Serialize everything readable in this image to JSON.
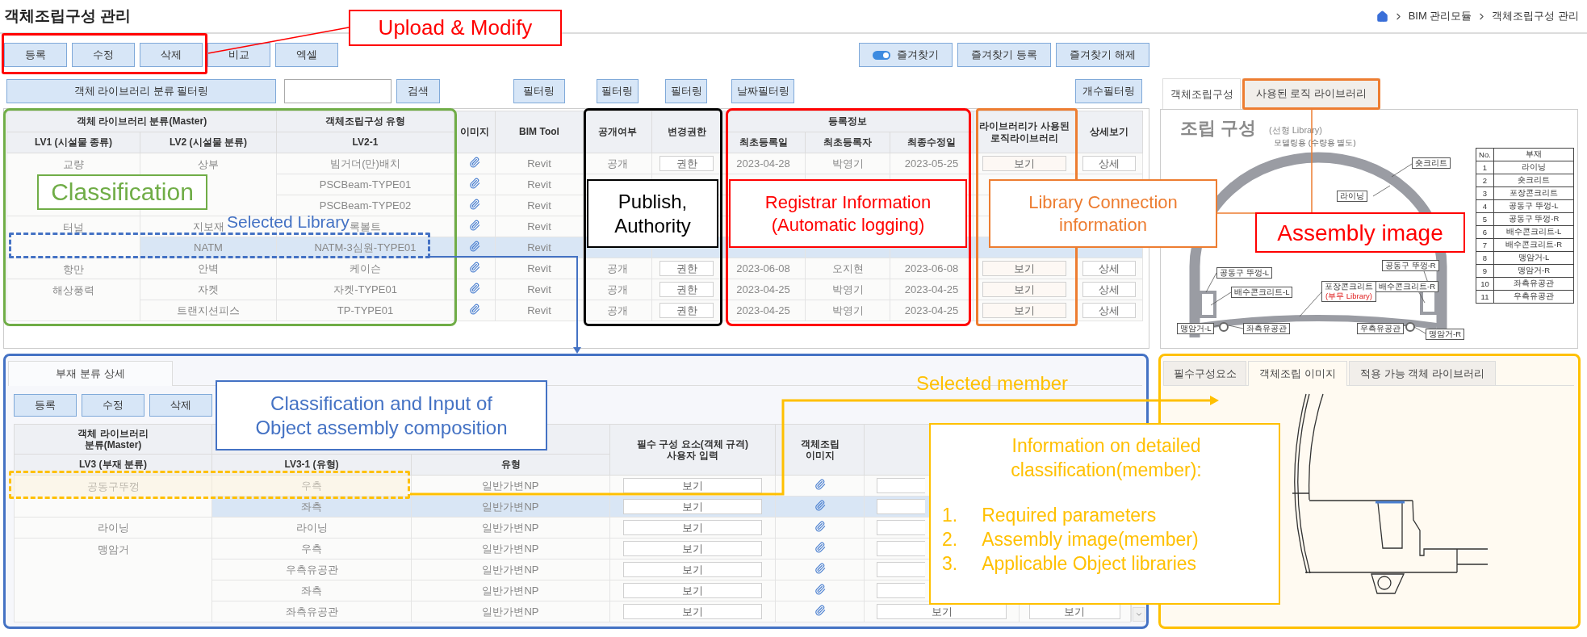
{
  "header": {
    "title": "객체조립구성 관리",
    "breadcrumb": [
      "BIM 관리모듈",
      "객체조립구성 관리"
    ]
  },
  "toolbar": {
    "actions": [
      "등록",
      "수정",
      "삭제",
      "비교",
      "엑셀"
    ],
    "favorites": {
      "label": "즐겨찾기",
      "on": true
    },
    "favorite_actions": [
      "즐겨찾기 등록",
      "즐겨찾기 해제"
    ]
  },
  "filters": {
    "category": "객체 라이브러리 분류 필터링",
    "search_button": "검색",
    "tool_filter": "필터링",
    "public_filter": "필터링",
    "authority_filter": "필터링",
    "date_filter": "날짜필터링",
    "count_filter": "개수필터링"
  },
  "library_table": {
    "header": {
      "master": "객체 라이브러리 분류(Master)",
      "assembly_type": "객체조립구성 유형",
      "lv1": "LV1 (시설물 종류)",
      "lv2": "LV2 (시설물 분류)",
      "lv2_1": "LV2-1",
      "image": "이미지",
      "tool": "BIM Tool",
      "public": "공개여부",
      "authority": "변경권한",
      "registration": "등록정보",
      "registered": "최초등록일",
      "registrar": "최초등록자",
      "modified": "최종수정일",
      "logic_library": "라이브러리가 사용된\n로직라이브러리",
      "detail": "상세보기"
    },
    "groups": [
      {
        "lv1": "교량",
        "subgroups": [
          {
            "lv2": "상부",
            "items": [
              {
                "type": "빔거더(만)배치",
                "tool": "Revit",
                "public": "공개",
                "authority": "권한",
                "registered": "2023-04-28",
                "registrar": "박영기",
                "modified": "2023-05-25",
                "logic": "보기",
                "detail": "상세",
                "selected": false
              },
              {
                "type": "PSCBeam-TYPE01",
                "tool": "Revit",
                "selected": false
              },
              {
                "type": "PSCBeam-TYPE02",
                "tool": "Revit",
                "selected": false
              }
            ]
          }
        ]
      },
      {
        "lv1": "터널",
        "subgroups": [
          {
            "lv2": "지보재",
            "items": [
              {
                "type": "록볼트",
                "tool": "Revit",
                "selected": false
              }
            ]
          },
          {
            "lv2": "NATM",
            "items": [
              {
                "type": "NATM-3심원-TYPE01",
                "tool": "Revit",
                "selected": true
              }
            ]
          }
        ]
      },
      {
        "lv1": "항만",
        "subgroups": [
          {
            "lv2": "안벽",
            "items": [
              {
                "type": "케이슨",
                "tool": "Revit",
                "public": "공개",
                "authority": "권한",
                "registered": "2023-06-08",
                "registrar": "오지현",
                "modified": "2023-06-08",
                "logic": "보기",
                "detail": "상세",
                "selected": false
              }
            ]
          }
        ]
      },
      {
        "lv1": "해상풍력",
        "subgroups": [
          {
            "lv2": "자켓",
            "items": [
              {
                "type": "자켓-TYPE01",
                "tool": "Revit",
                "public": "공개",
                "authority": "권한",
                "registered": "2023-04-25",
                "registrar": "박영기",
                "modified": "2023-04-25",
                "logic": "보기",
                "detail": "상세",
                "selected": false
              }
            ]
          },
          {
            "lv2": "트랜지션피스",
            "items": [
              {
                "type": "TP-TYPE01",
                "tool": "Revit",
                "public": "공개",
                "authority": "권한",
                "registered": "2023-04-25",
                "registrar": "박영기",
                "modified": "2023-04-25",
                "logic": "보기",
                "detail": "상세",
                "selected": false
              }
            ]
          }
        ]
      }
    ]
  },
  "assembly_panel": {
    "tabs": [
      {
        "label": "객체조립구성",
        "selected": true
      },
      {
        "label": "사용된 로직 라이브러리",
        "selected": false
      }
    ],
    "drawing": {
      "title": "조립 구성",
      "subtitle": "(선형 Library)",
      "note": "모델링용 (수량용 별도)",
      "callouts": [
        {
          "text": "숏크리트"
        },
        {
          "text": "라이닝"
        },
        {
          "text": "공동구 뚜껑-L"
        },
        {
          "text": "배수콘크리트-L"
        },
        {
          "text": "포장콘크리트",
          "note": "(부무 Library)"
        },
        {
          "text": "공동구 뚜껑-R"
        },
        {
          "text": "배수콘크리트-R"
        },
        {
          "text": "맹암거-L"
        },
        {
          "text": "좌측유공관"
        },
        {
          "text": "우측유공관"
        },
        {
          "text": "맹암거-R"
        }
      ],
      "parts_header": [
        "No.",
        "부재"
      ],
      "parts": [
        {
          "no": "1",
          "name": "라이닝"
        },
        {
          "no": "2",
          "name": "숏크리트"
        },
        {
          "no": "3",
          "name": "포장콘크리트"
        },
        {
          "no": "4",
          "name": "공동구 뚜껑-L"
        },
        {
          "no": "5",
          "name": "공동구 뚜껑-R"
        },
        {
          "no": "6",
          "name": "배수콘크리트-L"
        },
        {
          "no": "7",
          "name": "배수콘크리트-R"
        },
        {
          "no": "8",
          "name": "맹암거-L"
        },
        {
          "no": "9",
          "name": "맹암거-R"
        },
        {
          "no": "10",
          "name": "좌측유공관"
        },
        {
          "no": "11",
          "name": "우측유공관"
        }
      ]
    }
  },
  "member_panel": {
    "tabs": [
      {
        "label": "부재 분류 상세",
        "selected": true
      }
    ],
    "actions": [
      "등록",
      "수정",
      "삭제"
    ],
    "table": {
      "header": {
        "master": "객체 라이브러리\n분류(Master)",
        "lv3": "LV3 (부재 분류)",
        "lv3_1": "LV3-1 (유형)",
        "variant": "유형",
        "required": "필수 구성 요소(객체 규격)\n사용자 입력",
        "image": "객체조립\n이미지"
      },
      "groups": [
        {
          "lv3": "공동구뚜껑",
          "items": [
            {
              "type": "우측",
              "variant": "일반가변NP",
              "required": "보기",
              "selected": false
            },
            {
              "type": "좌측",
              "variant": "일반가변NP",
              "required": "보기",
              "selected": true
            }
          ]
        },
        {
          "lv3": "라이닝",
          "items": [
            {
              "type": "라이닝",
              "variant": "일반가변NP",
              "required": "보기",
              "selected": false
            }
          ]
        },
        {
          "lv3": "맹암거",
          "items": [
            {
              "type": "우측",
              "variant": "일반가변NP",
              "required": "보기",
              "selected": false
            },
            {
              "type": "우측유공관",
              "variant": "일반가변NP",
              "required": "보기",
              "selected": false
            },
            {
              "type": "좌측",
              "variant": "일반가변NP",
              "required": "보기",
              "selected": false
            },
            {
              "type": "좌측유공관",
              "variant": "일반가변NP",
              "required": "보기",
              "column_6": "보기",
              "column_7": "보기",
              "selected": false
            }
          ]
        }
      ]
    }
  },
  "detail_panel": {
    "tabs": [
      {
        "label": "필수구성요소",
        "selected": false
      },
      {
        "label": "객체조립 이미지",
        "selected": true
      },
      {
        "label": "적용 가능 객체 라이브러리",
        "selected": false
      }
    ]
  },
  "annotations": [
    {
      "kind": "boxed",
      "text": "Upload & Modify",
      "color": "#ff0000"
    },
    {
      "kind": "boxed",
      "text": "Classification",
      "color": "#70ad47"
    },
    {
      "kind": "plain",
      "text": "Selected Library",
      "color": "#4472c4"
    },
    {
      "kind": "boxed",
      "text": "Publish,\nAuthority",
      "color": "#000000"
    },
    {
      "kind": "boxed",
      "text": "Registrar Information\n(Automatic logging)",
      "color": "#ff0000"
    },
    {
      "kind": "boxed",
      "text": "Library Connection\ninformation",
      "color": "#ed7d31"
    },
    {
      "kind": "boxed",
      "text": "Assembly image",
      "color": "#ff0000"
    },
    {
      "kind": "boxed",
      "text": "Classification and Input of\nObject assembly composition",
      "color": "#4472c4"
    },
    {
      "kind": "plain",
      "text": "Selected member",
      "color": "#ffc000"
    },
    {
      "kind": "list",
      "text": "Information on detailed\nclassification(member):",
      "color": "#ffc000",
      "items": [
        {
          "number": "1.",
          "text": "Required parameters"
        },
        {
          "number": "2.",
          "text": "Assembly image(member)"
        },
        {
          "number": "3.",
          "text": "Applicable Object libraries"
        }
      ]
    }
  ]
}
